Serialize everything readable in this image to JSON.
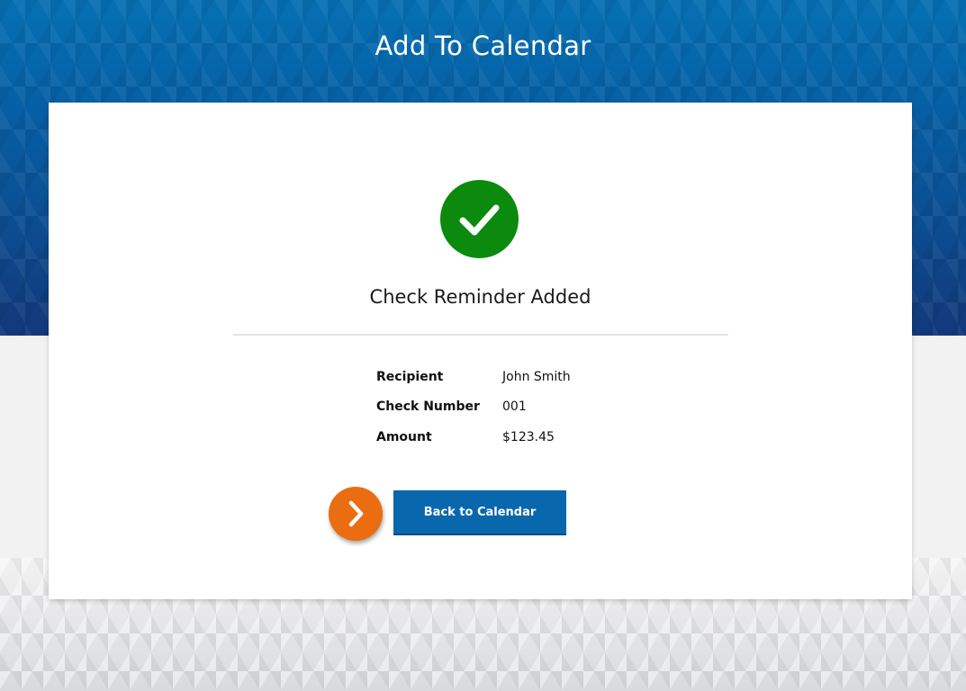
{
  "header": {
    "title": "Add To Calendar"
  },
  "status": {
    "icon": "checkmark-icon",
    "icon_color": "#0b8a0e",
    "title": "Check Reminder Added"
  },
  "details": [
    {
      "label": "Recipient",
      "value": "John Smith"
    },
    {
      "label": "Check Number",
      "value": "001"
    },
    {
      "label": "Amount",
      "value": "$123.45"
    }
  ],
  "actions": {
    "arrow_icon": "chevron-right-icon",
    "arrow_color": "#eb6d11",
    "back_label": "Back to Calendar",
    "back_color": "#0967ad"
  },
  "colors": {
    "header_blue": "#0670b3",
    "background": "#f2f2f3"
  }
}
